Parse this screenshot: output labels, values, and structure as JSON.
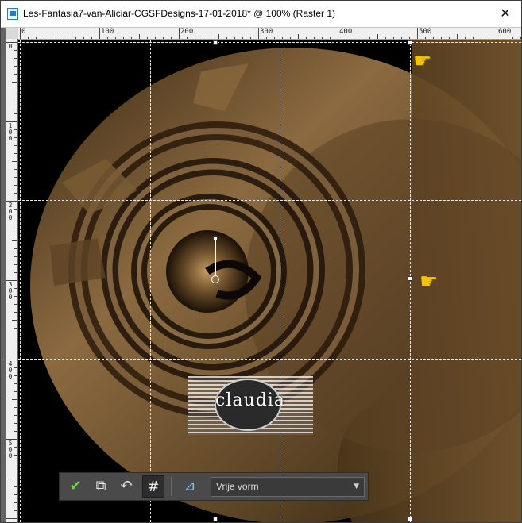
{
  "window": {
    "title": "Les-Fantasia7-van-Aliciar-CGSFDesigns-17-01-2018* @ 100% (Raster 1)",
    "close_glyph": "✕"
  },
  "ruler": {
    "top_labels": [
      "0",
      "100",
      "200",
      "300",
      "400",
      "500",
      "600"
    ],
    "left_labels": [
      "0",
      "100",
      "200",
      "300",
      "400",
      "500"
    ]
  },
  "watermark": {
    "text": "claudia"
  },
  "toolbar": {
    "apply_icon": "checkmark-icon",
    "apply_glyph": "✔",
    "edit_selection_icon": "transform-icon",
    "edit_selection_glyph": "⧉",
    "reset_icon": "undo-arrow-icon",
    "reset_glyph": "↶",
    "grid_icon": "grid-icon",
    "grid_glyph": "#",
    "options_icon": "ruler-square-icon",
    "options_glyph": "⊿",
    "mode_select": {
      "value": "Vrije vorm"
    }
  },
  "pointers": {
    "glyph": "☛"
  },
  "colors": {
    "bronze_light": "#9a774c",
    "bronze_dark": "#3b2a18",
    "bronze_mid": "#6e5230",
    "background": "#000000"
  }
}
